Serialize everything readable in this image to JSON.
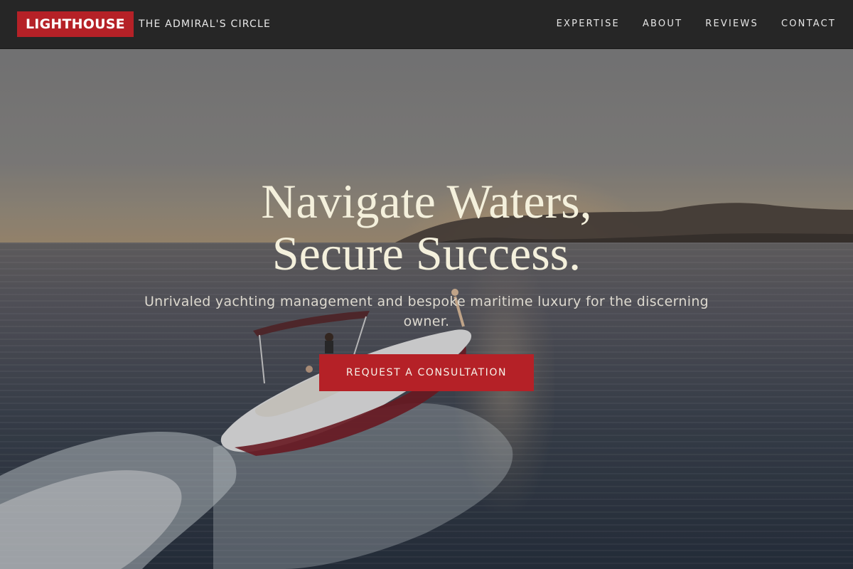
{
  "brand": {
    "logo": "LIGHTHOUSE",
    "tagline": "THE ADMIRAL'S CIRCLE"
  },
  "nav": {
    "items": [
      "EXPERTISE",
      "ABOUT",
      "REVIEWS",
      "CONTACT"
    ]
  },
  "hero": {
    "title_line1": "Navigate Waters,",
    "title_line2": "Secure Success.",
    "subtitle": "Unrivaled yachting management and bespoke maritime luxury for the discerning owner.",
    "cta_label": "REQUEST A CONSULTATION",
    "background_image": "speedboat cruising on open sea at sunset"
  },
  "colors": {
    "accent": "#b52127",
    "header_bg": "#262626",
    "title_text": "#f4f0dc"
  }
}
